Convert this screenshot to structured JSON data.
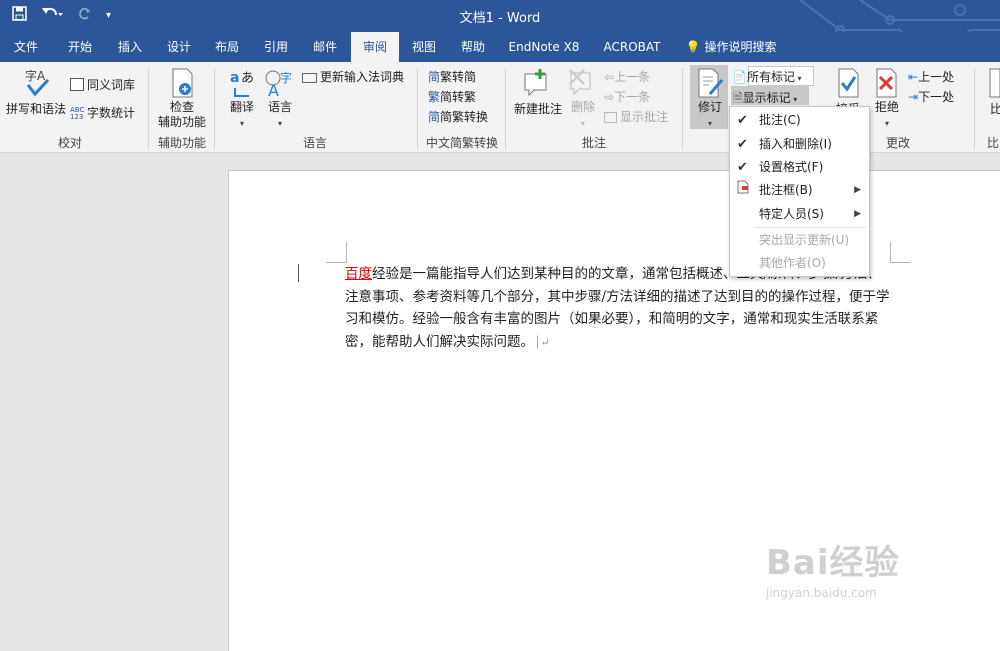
{
  "titlebar": {
    "doc_title": "文档1  -  Word",
    "save_icon": "save-icon",
    "undo_icon": "undo-icon",
    "redo_icon": "redo-icon",
    "customize_icon": "customize-qat-icon"
  },
  "tabs": [
    "文件",
    "开始",
    "插入",
    "设计",
    "布局",
    "引用",
    "邮件",
    "审阅",
    "视图",
    "帮助",
    "EndNote X8",
    "ACROBAT",
    "操作说明搜索"
  ],
  "active_tab": "审阅",
  "ribbon": {
    "proofing": {
      "spelling": "拼写和语法",
      "thesaurus": "同义词库",
      "word_count": "字数统计",
      "label": "校对"
    },
    "accessibility": {
      "check1": "检查",
      "check2": "辅助功能",
      "label": "辅助功能"
    },
    "language": {
      "translate": "翻译",
      "language": "语言",
      "update_ime": "更新输入法词典",
      "label": "语言"
    },
    "chinese": {
      "to_simplified": "繁转简",
      "to_traditional": "简转繁",
      "convert": "简繁转换",
      "label": "中文简繁转换"
    },
    "comments": {
      "new": "新建批注",
      "delete": "删除",
      "previous": "上一条",
      "next": "下一条",
      "show": "显示批注",
      "label": "批注"
    },
    "tracking": {
      "track": "修订",
      "all_markup": "所有标记",
      "show_markup": "显示标记"
    },
    "changes": {
      "accept": "接受",
      "reject": "拒绝",
      "previous": "上一处",
      "next": "下一处",
      "label": "更改"
    },
    "compare": {
      "compare": "比",
      "label": "比"
    }
  },
  "dropdown": {
    "items": [
      {
        "label": "批注(C)",
        "checked": true
      },
      {
        "label": "插入和删除(I)",
        "checked": true
      },
      {
        "label": "设置格式(F)",
        "checked": true
      },
      {
        "label": "批注框(B)",
        "icon": "balloons-icon",
        "submenu": true
      },
      {
        "label": "特定人员(S)",
        "submenu": true
      },
      {
        "label": "突出显示更新(U)",
        "disabled": true
      },
      {
        "label": "其他作者(O)",
        "disabled": true
      }
    ]
  },
  "document": {
    "link": "百度",
    "text": "经验是一篇能指导人们达到某种目的的文章，通常包括概述、工具/原料、步骤/方法、注意事项、参考资料等几个部分，其中步骤/方法详细的描述了达到目的的操作过程，便于学习和模仿。经验一般含有丰富的图片（如果必要），和简明的文字，通常和现实生活联系紧密，能帮助人们解决实际问题。"
  },
  "watermark": {
    "brand": "Bai经验",
    "url": "jingyan.baidu.com"
  },
  "colors": {
    "accent": "#2b579a",
    "ribbon_bg": "#f3f3f3",
    "link": "#e00000"
  }
}
